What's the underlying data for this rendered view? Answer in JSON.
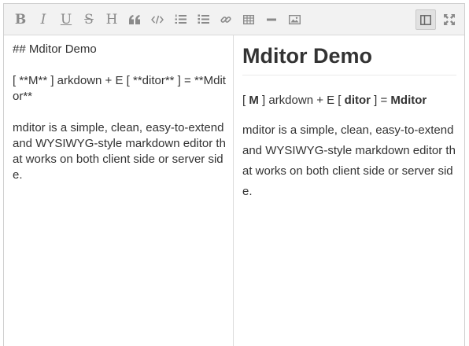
{
  "toolbar": {
    "buttons": [
      {
        "name": "bold",
        "glyph": "B"
      },
      {
        "name": "italic",
        "glyph": "I"
      },
      {
        "name": "underline",
        "glyph": "U"
      },
      {
        "name": "strikethrough",
        "glyph": "S"
      },
      {
        "name": "heading",
        "glyph": "H"
      },
      {
        "name": "quote",
        "glyph": "❝"
      },
      {
        "name": "code",
        "glyph": "</>"
      },
      {
        "name": "ordered-list",
        "glyph": "ol"
      },
      {
        "name": "unordered-list",
        "glyph": "ul"
      },
      {
        "name": "link",
        "glyph": "link"
      },
      {
        "name": "table",
        "glyph": "table"
      },
      {
        "name": "horizontal-rule",
        "glyph": "—"
      },
      {
        "name": "image",
        "glyph": "img"
      }
    ],
    "right_buttons": [
      {
        "name": "split-preview",
        "active": true
      },
      {
        "name": "fullscreen",
        "active": false
      }
    ],
    "icon_color": "#8a8a8a"
  },
  "source": {
    "line1": "## Mditor Demo",
    "line2": "[ **M** ] arkdown + E [ **ditor** ] = **Mditor**",
    "line3": "mditor is a simple, clean, easy-to-extend and WYSIWYG-style markdown editor that works on both client side or server side."
  },
  "preview": {
    "heading": "Mditor Demo",
    "line_parts": {
      "p1": "[ ",
      "b1": "M",
      "p2": " ] arkdown + E [ ",
      "b2": "ditor",
      "p3": " ] = ",
      "b3": "Mditor"
    },
    "description": "mditor is a simple, clean, easy-to-extend and WYSIWYG-style markdown editor that works on both client side or server side."
  }
}
